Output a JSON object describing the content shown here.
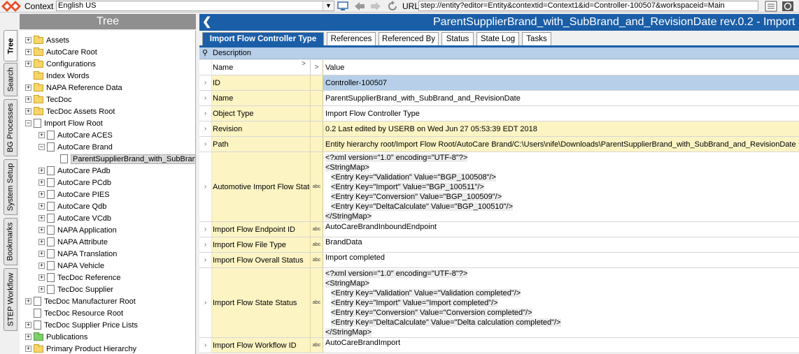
{
  "toolbar": {
    "context_label": "Context",
    "context_value": "English US",
    "url_label": "URL",
    "url_value": "step://entity?editor=Entity&contextid=Context1&id=Controller-100507&workspaceid=Main"
  },
  "side_tabs": [
    "Tree",
    "Search",
    "BG Processes",
    "System Setup",
    "Bookmarks",
    "STEP Workflow"
  ],
  "tree": {
    "title": "Tree",
    "nodes": [
      {
        "label": "Assets"
      },
      {
        "label": "AutoCare Root"
      },
      {
        "label": "Configurations"
      },
      {
        "label": "Index Words"
      },
      {
        "label": "NAPA Reference Data"
      },
      {
        "label": "TecDoc"
      },
      {
        "label": "TecDoc Assets Root"
      },
      {
        "label": "Import Flow Root"
      },
      {
        "label": "AutoCare ACES"
      },
      {
        "label": "AutoCare Brand"
      },
      {
        "label": "ParentSupplierBrand_with_SubBrand"
      },
      {
        "label": "AutoCare PAdb"
      },
      {
        "label": "AutoCare PCdb"
      },
      {
        "label": "AutoCare PIES"
      },
      {
        "label": "AutoCare Qdb"
      },
      {
        "label": "AutoCare VCdb"
      },
      {
        "label": "NAPA Application"
      },
      {
        "label": "NAPA Attribute"
      },
      {
        "label": "NAPA Translation"
      },
      {
        "label": "NAPA Vehicle"
      },
      {
        "label": "TecDoc Reference"
      },
      {
        "label": "TecDoc Supplier"
      },
      {
        "label": "TecDoc Manufacturer Root"
      },
      {
        "label": "TecDoc Resource Root"
      },
      {
        "label": "TecDoc Supplier Price Lists"
      },
      {
        "label": "Publications"
      },
      {
        "label": "Primary Product Hierarchy"
      }
    ]
  },
  "main": {
    "title": "ParentSupplierBrand_with_SubBrand_and_RevisionDate rev.0.2 - Import",
    "tabs": [
      "Import Flow Controller Type",
      "References",
      "Referenced By",
      "Status",
      "State Log",
      "Tasks"
    ],
    "description_label": "Description",
    "grid_header": {
      "name": "Name",
      "value": "Value",
      "expand": ">"
    },
    "type_icon": "abc",
    "rows": [
      {
        "name": "ID",
        "value": "Controller-100507"
      },
      {
        "name": "Name",
        "value": "ParentSupplierBrand_with_SubBrand_and_RevisionDate"
      },
      {
        "name": "Object Type",
        "value": "Import Flow Controller Type"
      },
      {
        "name": "Revision",
        "value": "0.2 Last edited by USERB on Wed Jun 27 05:53:39 EDT 2018"
      },
      {
        "name": "Path",
        "value": "Entity hierarchy root/Import Flow Root/AutoCare Brand/C:\\Users\\nife\\Downloads\\ParentSupplierBrand_with_SubBrand_and_RevisionDate"
      },
      {
        "name": "Automotive Import Flow State",
        "lines": [
          "<?xml version=\"1.0\" encoding=\"UTF-8\"?>",
          "<StringMap>",
          "  <Entry Key=\"Validation\" Value=\"BGP_100508\"/>",
          "  <Entry Key=\"Import\" Value=\"BGP_100511\"/>",
          "  <Entry Key=\"Conversion\" Value=\"BGP_100509\"/>",
          "  <Entry Key=\"DeltaCalculate\" Value=\"BGP_100510\"/>",
          "</StringMap>"
        ]
      },
      {
        "name": "Import Flow Endpoint ID",
        "value": "AutoCareBrandInboundEndpoint"
      },
      {
        "name": "Import Flow File Type",
        "value": "BrandData"
      },
      {
        "name": "Import Flow Overall Status",
        "value": "Import completed"
      },
      {
        "name": "Import Flow State Status",
        "lines": [
          "<?xml version=\"1.0\" encoding=\"UTF-8\"?>",
          "<StringMap>",
          "  <Entry Key=\"Validation\" Value=\"Validation completed\"/>",
          "  <Entry Key=\"Import\" Value=\"Import completed\"/>",
          "  <Entry Key=\"Conversion\" Value=\"Conversion completed\"/>",
          "  <Entry Key=\"DeltaCalculate\" Value=\"Delta calculation completed\"/>",
          "</StringMap>"
        ]
      },
      {
        "name": "Import Flow Workflow ID",
        "value": "AutoCareBrandImport"
      }
    ]
  },
  "colors": {
    "accent": "#1b5ea8",
    "tree_header": "#8f8f8f",
    "name_cell": "#fdf4c4",
    "selected_row": "#b7cfe9"
  }
}
